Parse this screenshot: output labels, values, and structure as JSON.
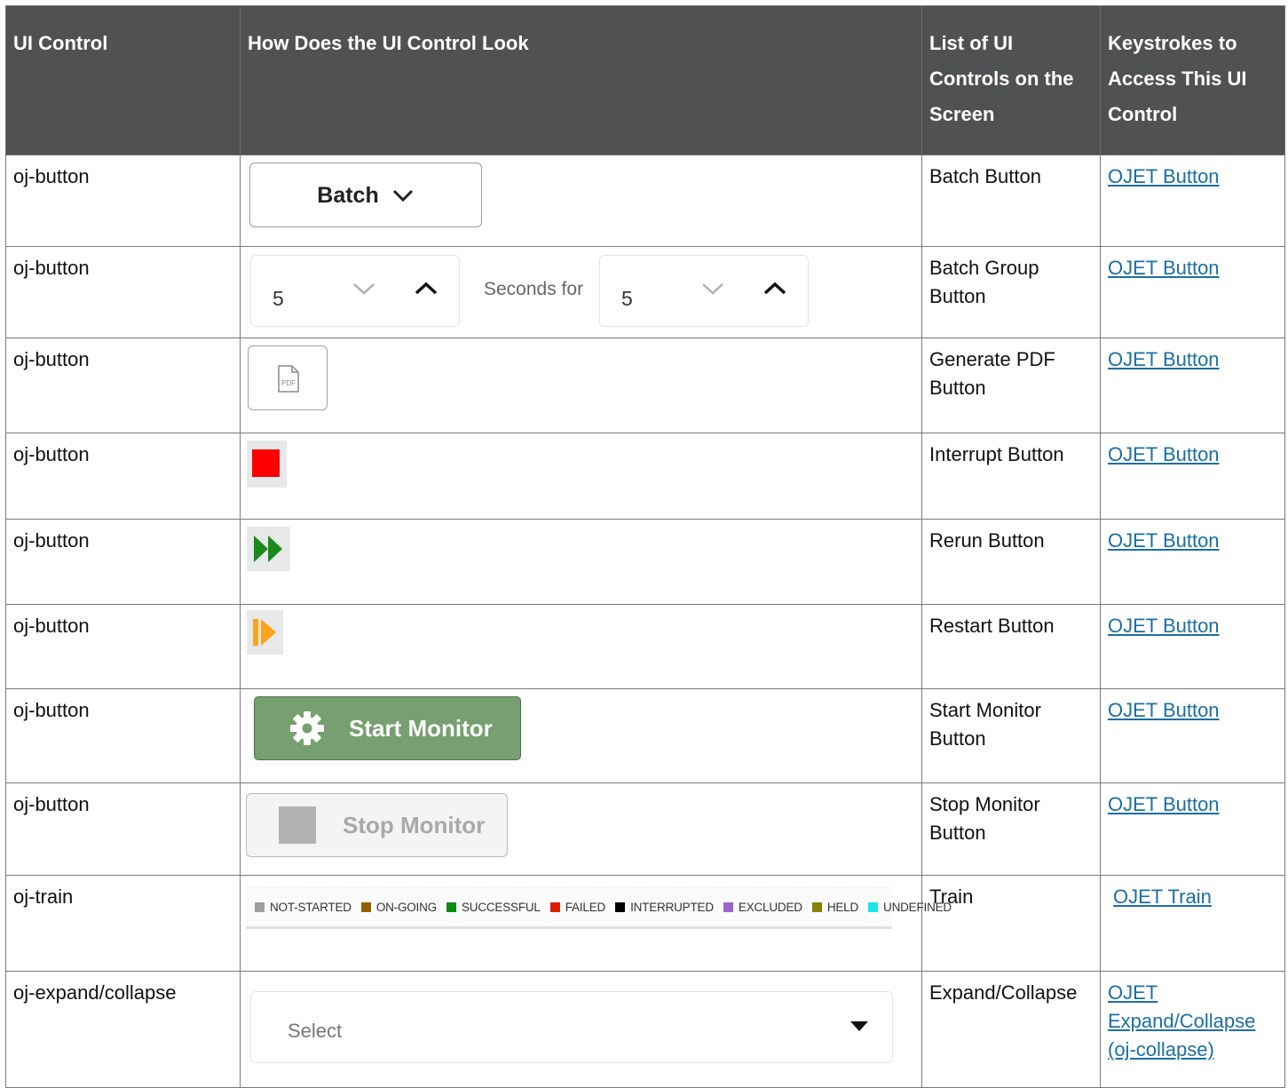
{
  "headers": {
    "control": "UI Control",
    "look": "How Does the UI Control Look",
    "list": "List of UI Controls on the Screen",
    "keys": "Keystrokes to Access This UI Control"
  },
  "rows": [
    {
      "control": "oj-button",
      "list": "Batch Button",
      "link": "OJET Button"
    },
    {
      "control": "oj-button",
      "list": "Batch Group Button",
      "link": "OJET Button"
    },
    {
      "control": "oj-button",
      "list": "Generate PDF Button",
      "link": "OJET Button"
    },
    {
      "control": "oj-button",
      "list": "Interrupt Button",
      "link": "OJET Button"
    },
    {
      "control": "oj-button",
      "list": "Rerun Button",
      "link": "OJET Button"
    },
    {
      "control": "oj-button",
      "list": "Restart Button",
      "link": "OJET Button"
    },
    {
      "control": "oj-button",
      "list": "Start Monitor Button",
      "link": "OJET Button"
    },
    {
      "control": "oj-button",
      "list": "Stop Monitor Button",
      "link": "OJET Button"
    },
    {
      "control": "oj-train",
      "list": "Train",
      "link": "OJET Train"
    },
    {
      "control": "oj-expand/collapse",
      "list": "Expand/Collapse",
      "link": "OJET Expand/Collapse (oj-collapse)"
    }
  ],
  "looks": {
    "batch_label": "Batch",
    "group_value_1": "5",
    "group_middle": "Seconds for",
    "group_value_2": "5",
    "pdf_icon_text": "PDF",
    "start_label": "Start Monitor",
    "stop_label": "Stop Monitor",
    "select_placeholder": "Select"
  },
  "train": [
    {
      "label": "NOT-STARTED",
      "color": "#9e9e9e"
    },
    {
      "label": "ON-GOING",
      "color": "#8f6200"
    },
    {
      "label": "SUCCESSFUL",
      "color": "#0e8a16"
    },
    {
      "label": "FAILED",
      "color": "#e01f00"
    },
    {
      "label": "INTERRUPTED",
      "color": "#000000"
    },
    {
      "label": "EXCLUDED",
      "color": "#9966cc"
    },
    {
      "label": "HELD",
      "color": "#858500"
    },
    {
      "label": "UNDEFINED",
      "color": "#19e6e6"
    }
  ],
  "colors": {
    "header_bg": "#505153",
    "link": "#1a6fa4",
    "interrupt": "#ff0000",
    "rerun": "#1a8a1a",
    "restart": "#ffa31a",
    "start_bg": "#76a06f"
  }
}
